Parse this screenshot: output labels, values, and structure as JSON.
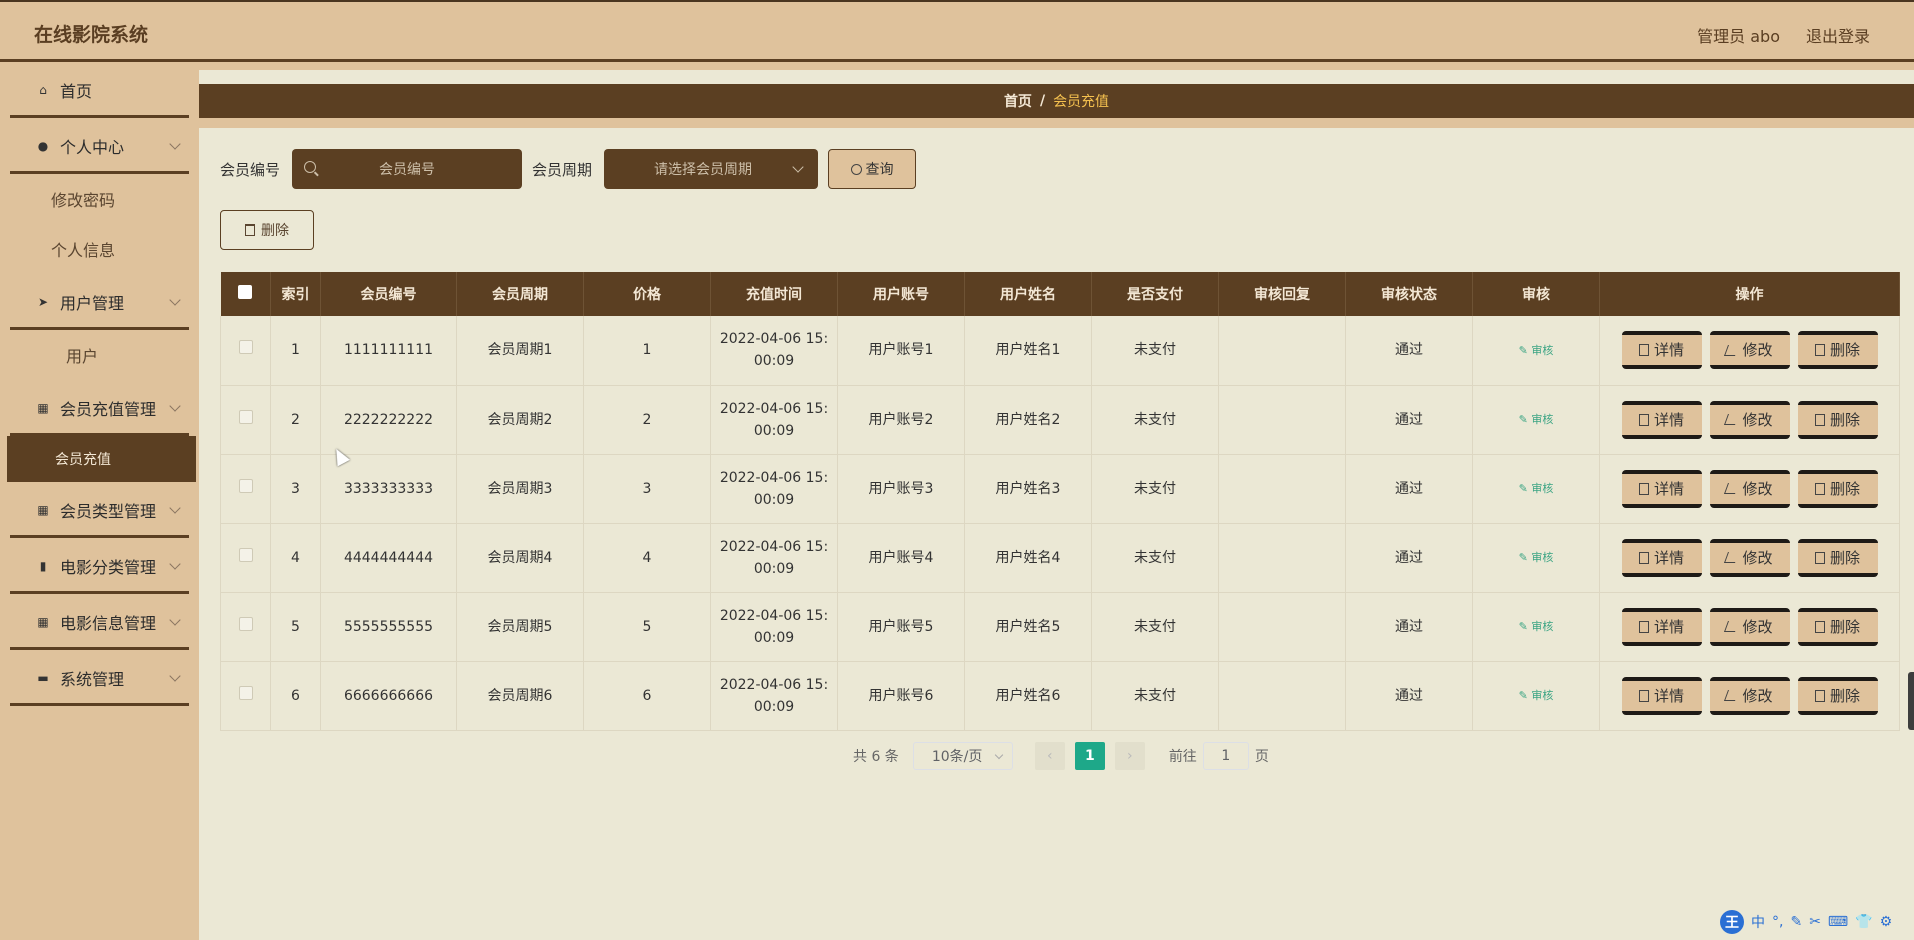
{
  "app": {
    "title": "在线影院系统",
    "user_label": "管理员 abo",
    "logout_label": "退出登录"
  },
  "sidebar": {
    "home": "首页",
    "personal_center": "个人中心",
    "change_password": "修改密码",
    "personal_info": "个人信息",
    "user_mgmt": "用户管理",
    "user": "用户",
    "member_recharge_mgmt": "会员充值管理",
    "member_recharge": "会员充值",
    "member_type_mgmt": "会员类型管理",
    "movie_category_mgmt": "电影分类管理",
    "movie_info_mgmt": "电影信息管理",
    "system_mgmt": "系统管理"
  },
  "breadcrumb": {
    "home": "首页",
    "separator": "/",
    "current": "会员充值"
  },
  "search": {
    "member_no_label": "会员编号",
    "member_no_placeholder": "会员编号",
    "period_label": "会员周期",
    "period_placeholder": "请选择会员周期",
    "query_label": "查询"
  },
  "toolbar": {
    "delete_label": "删除"
  },
  "table": {
    "headers": [
      "索引",
      "会员编号",
      "会员周期",
      "价格",
      "充值时间",
      "用户账号",
      "用户姓名",
      "是否支付",
      "审核回复",
      "审核状态",
      "审核",
      "操作"
    ],
    "rows": [
      {
        "index": "1",
        "member_no": "1111111111",
        "period": "会员周期1",
        "price": "1",
        "time1": "2022-04-06 15:",
        "time2": "00:09",
        "account": "用户账号1",
        "name": "用户姓名1",
        "paid": "未支付",
        "reply": "",
        "status": "通过"
      },
      {
        "index": "2",
        "member_no": "2222222222",
        "period": "会员周期2",
        "price": "2",
        "time1": "2022-04-06 15:",
        "time2": "00:09",
        "account": "用户账号2",
        "name": "用户姓名2",
        "paid": "未支付",
        "reply": "",
        "status": "通过"
      },
      {
        "index": "3",
        "member_no": "3333333333",
        "period": "会员周期3",
        "price": "3",
        "time1": "2022-04-06 15:",
        "time2": "00:09",
        "account": "用户账号3",
        "name": "用户姓名3",
        "paid": "未支付",
        "reply": "",
        "status": "通过"
      },
      {
        "index": "4",
        "member_no": "4444444444",
        "period": "会员周期4",
        "price": "4",
        "time1": "2022-04-06 15:",
        "time2": "00:09",
        "account": "用户账号4",
        "name": "用户姓名4",
        "paid": "未支付",
        "reply": "",
        "status": "通过"
      },
      {
        "index": "5",
        "member_no": "5555555555",
        "period": "会员周期5",
        "price": "5",
        "time1": "2022-04-06 15:",
        "time2": "00:09",
        "account": "用户账号5",
        "name": "用户姓名5",
        "paid": "未支付",
        "reply": "",
        "status": "通过"
      },
      {
        "index": "6",
        "member_no": "6666666666",
        "period": "会员周期6",
        "price": "6",
        "time1": "2022-04-06 15:",
        "time2": "00:09",
        "account": "用户账号6",
        "name": "用户姓名6",
        "paid": "未支付",
        "reply": "",
        "status": "通过"
      }
    ],
    "audit_label": "审核",
    "detail_label": "详情",
    "edit_label": "修改",
    "delete_label": "删除"
  },
  "pagination": {
    "total": "共 6 条",
    "page_size": "10条/页",
    "current_page": "1",
    "goto_prefix": "前往",
    "goto_value": "1",
    "goto_suffix": "页"
  },
  "ime": {
    "logo": "王",
    "mode": "中",
    "punct": "°,"
  },
  "colors": {
    "brown_dark": "#5b3f22",
    "tan": "#dfc29c",
    "bg": "#ebe8d5",
    "accent_green": "#1ea889",
    "breadcrumb_current": "#f5c14f"
  }
}
